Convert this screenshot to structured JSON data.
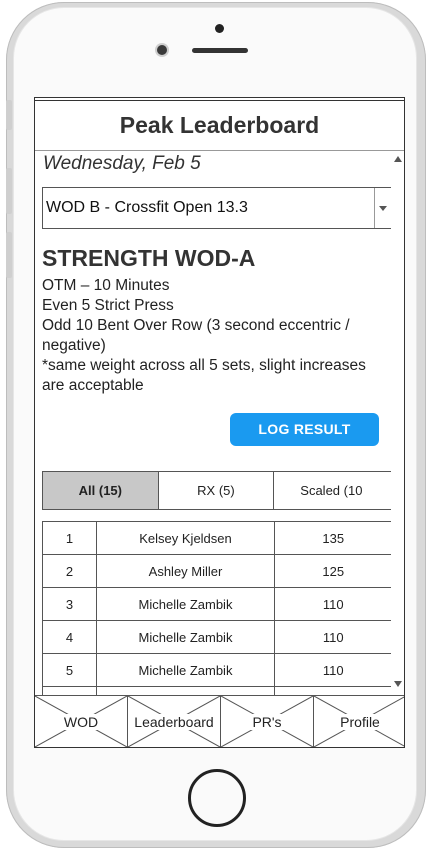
{
  "app": {
    "title": "Peak Leaderboard"
  },
  "date_label": "Wednesday, Feb 5",
  "wod_select": {
    "value": "WOD B - Crossfit Open 13.3"
  },
  "workout": {
    "heading": "STRENGTH WOD-A",
    "lines": [
      "OTM – 10 Minutes",
      "Even 5 Strict Press",
      "Odd 10 Bent Over Row (3 second eccentric / negative)",
      "*same weight across all 5 sets, slight increases are acceptable"
    ]
  },
  "log_button": "LOG RESULT",
  "filter_tabs": [
    {
      "label": "All (15)",
      "active": true
    },
    {
      "label": "RX (5)",
      "active": false
    },
    {
      "label": "Scaled (10",
      "active": false
    }
  ],
  "results": [
    {
      "rank": "1",
      "name": "Kelsey Kjeldsen",
      "score": "135"
    },
    {
      "rank": "2",
      "name": "Ashley Miller",
      "score": "125"
    },
    {
      "rank": "3",
      "name": "Michelle Zambik",
      "score": "110"
    },
    {
      "rank": "4",
      "name": "Michelle Zambik",
      "score": "110"
    },
    {
      "rank": "5",
      "name": "Michelle Zambik",
      "score": "110"
    },
    {
      "rank": "",
      "name": "",
      "score": ""
    }
  ],
  "bottom_nav": [
    {
      "label": "WOD"
    },
    {
      "label": "Leaderboard"
    },
    {
      "label": "PR's"
    },
    {
      "label": "Profile"
    }
  ],
  "colors": {
    "accent": "#1a9af0",
    "active_tab": "#c8c8c8"
  }
}
